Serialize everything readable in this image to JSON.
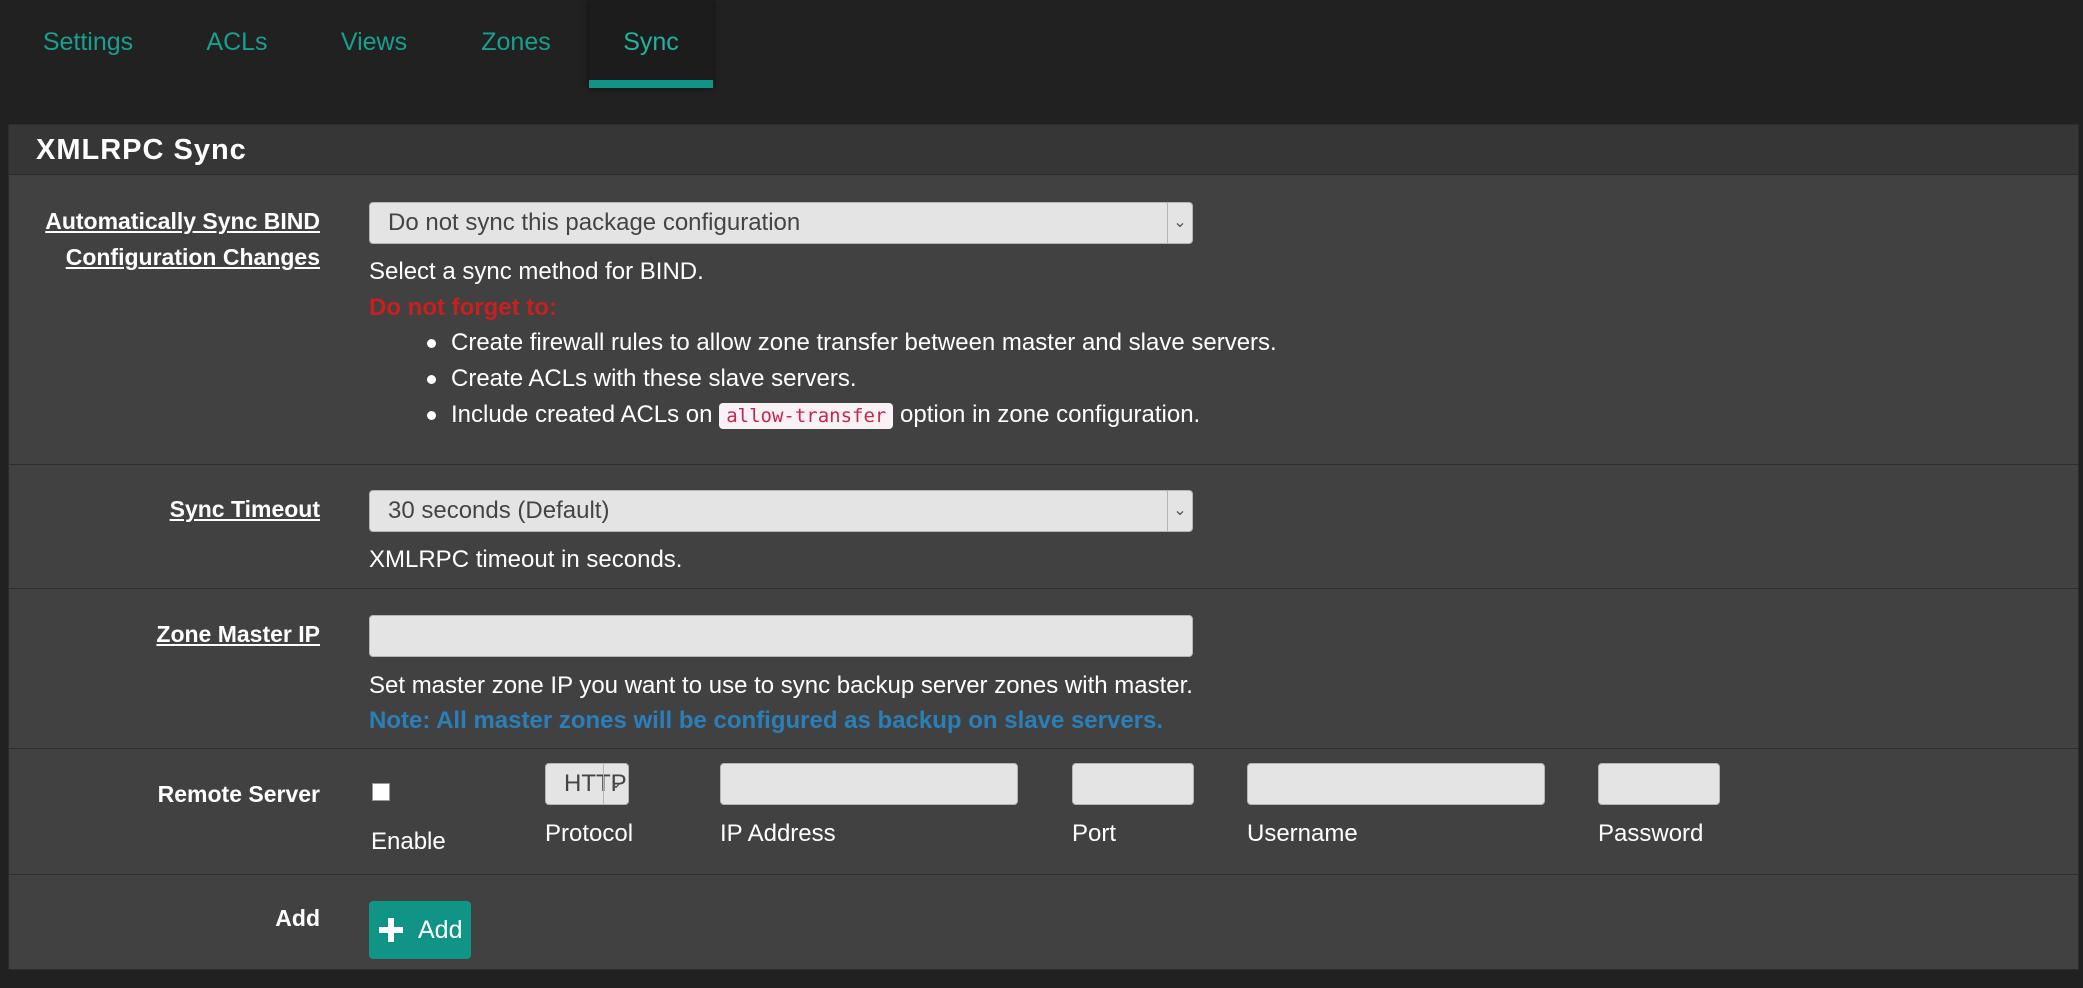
{
  "tabs": [
    {
      "label": "Settings",
      "active": false
    },
    {
      "label": "ACLs",
      "active": false
    },
    {
      "label": "Views",
      "active": false
    },
    {
      "label": "Zones",
      "active": false
    },
    {
      "label": "Sync",
      "active": true
    }
  ],
  "panel": {
    "title": "XMLRPC Sync"
  },
  "sync_bind": {
    "label_line1": "Automatically Sync BIND",
    "label_line2": "Configuration Changes",
    "selected": "Do not sync this package configuration",
    "help": "Select a sync method for BIND.",
    "warning": "Do not forget to:",
    "bullet1": "Create firewall rules to allow zone transfer between master and slave servers.",
    "bullet2": "Create ACLs with these slave servers.",
    "bullet3_before": "Include created ACLs on",
    "bullet3_code": "allow-transfer",
    "bullet3_after": "option in zone configuration."
  },
  "sync_timeout": {
    "label": "Sync Timeout",
    "selected": "30 seconds (Default)",
    "help": "XMLRPC timeout in seconds."
  },
  "zone_master_ip": {
    "label": "Zone Master IP",
    "value": "",
    "help": "Set master zone IP you want to use to sync backup server zones with master.",
    "note": "Note: All master zones will be configured as backup on slave servers."
  },
  "remote_server": {
    "label": "Remote Server",
    "enable_label": "Enable",
    "enabled": false,
    "protocol_selected": "HTTP",
    "protocol_label": "Protocol",
    "ip_label": "IP Address",
    "ip_value": "",
    "port_label": "Port",
    "port_value": "",
    "username_label": "Username",
    "username_value": "",
    "password_label": "Password",
    "password_value": ""
  },
  "add_row": {
    "label": "Add",
    "button_label": "Add"
  },
  "colors": {
    "accent": "#0f9485",
    "warning": "#c81f1f",
    "note": "#2b7fb8"
  }
}
